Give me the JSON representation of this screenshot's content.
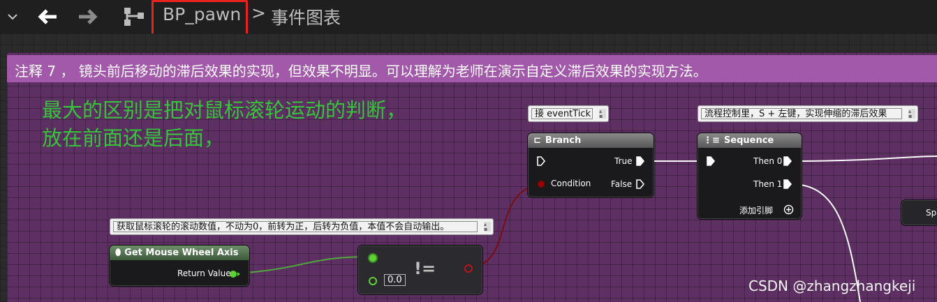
{
  "toolbar": {
    "breadcrumb_root": "BP_pawn",
    "breadcrumb_separator": ">",
    "breadcrumb_current": "事件图表"
  },
  "comment": {
    "title": "注释 7 ， 镜头前后移动的滞后效果的实现，但效果不明显。可以理解为老师在演示自定义滞后效果的实现方法。"
  },
  "note": {
    "line1": "最大的区别是把对鼠标滚轮运动的判断，",
    "line2": "放在前面还是后面，"
  },
  "branch": {
    "comment": "接 eventTick",
    "title": "Branch",
    "true_label": "True",
    "false_label": "False",
    "condition_label": "Condition"
  },
  "sequence": {
    "comment": "流程控制里，S + 左键，实现伸缩的滞后效果",
    "title": "Sequence",
    "then0_label": "Then 0",
    "then1_label": "Then 1",
    "add_pin_label": "添加引脚"
  },
  "mouse_wheel": {
    "comment": "获取鼠标滚轮的滚动数值，不动为0，前转为正，后转为负值，本值不会自动输出。",
    "title": "Get Mouse Wheel Axis",
    "return_label": "Return Value"
  },
  "not_equal": {
    "operator": "!=",
    "default_value": "0.0"
  },
  "partial_node": {
    "title": "Spr"
  },
  "watermark": "CSDN @zhangzhangkeji",
  "colors": {
    "comment_bar": "#a259aa",
    "comment_body": "#5e2f63",
    "note_text": "#36c43a",
    "highlight_box": "#e8221c",
    "bool_pin": "#950000",
    "float_pin": "#5fd233"
  }
}
